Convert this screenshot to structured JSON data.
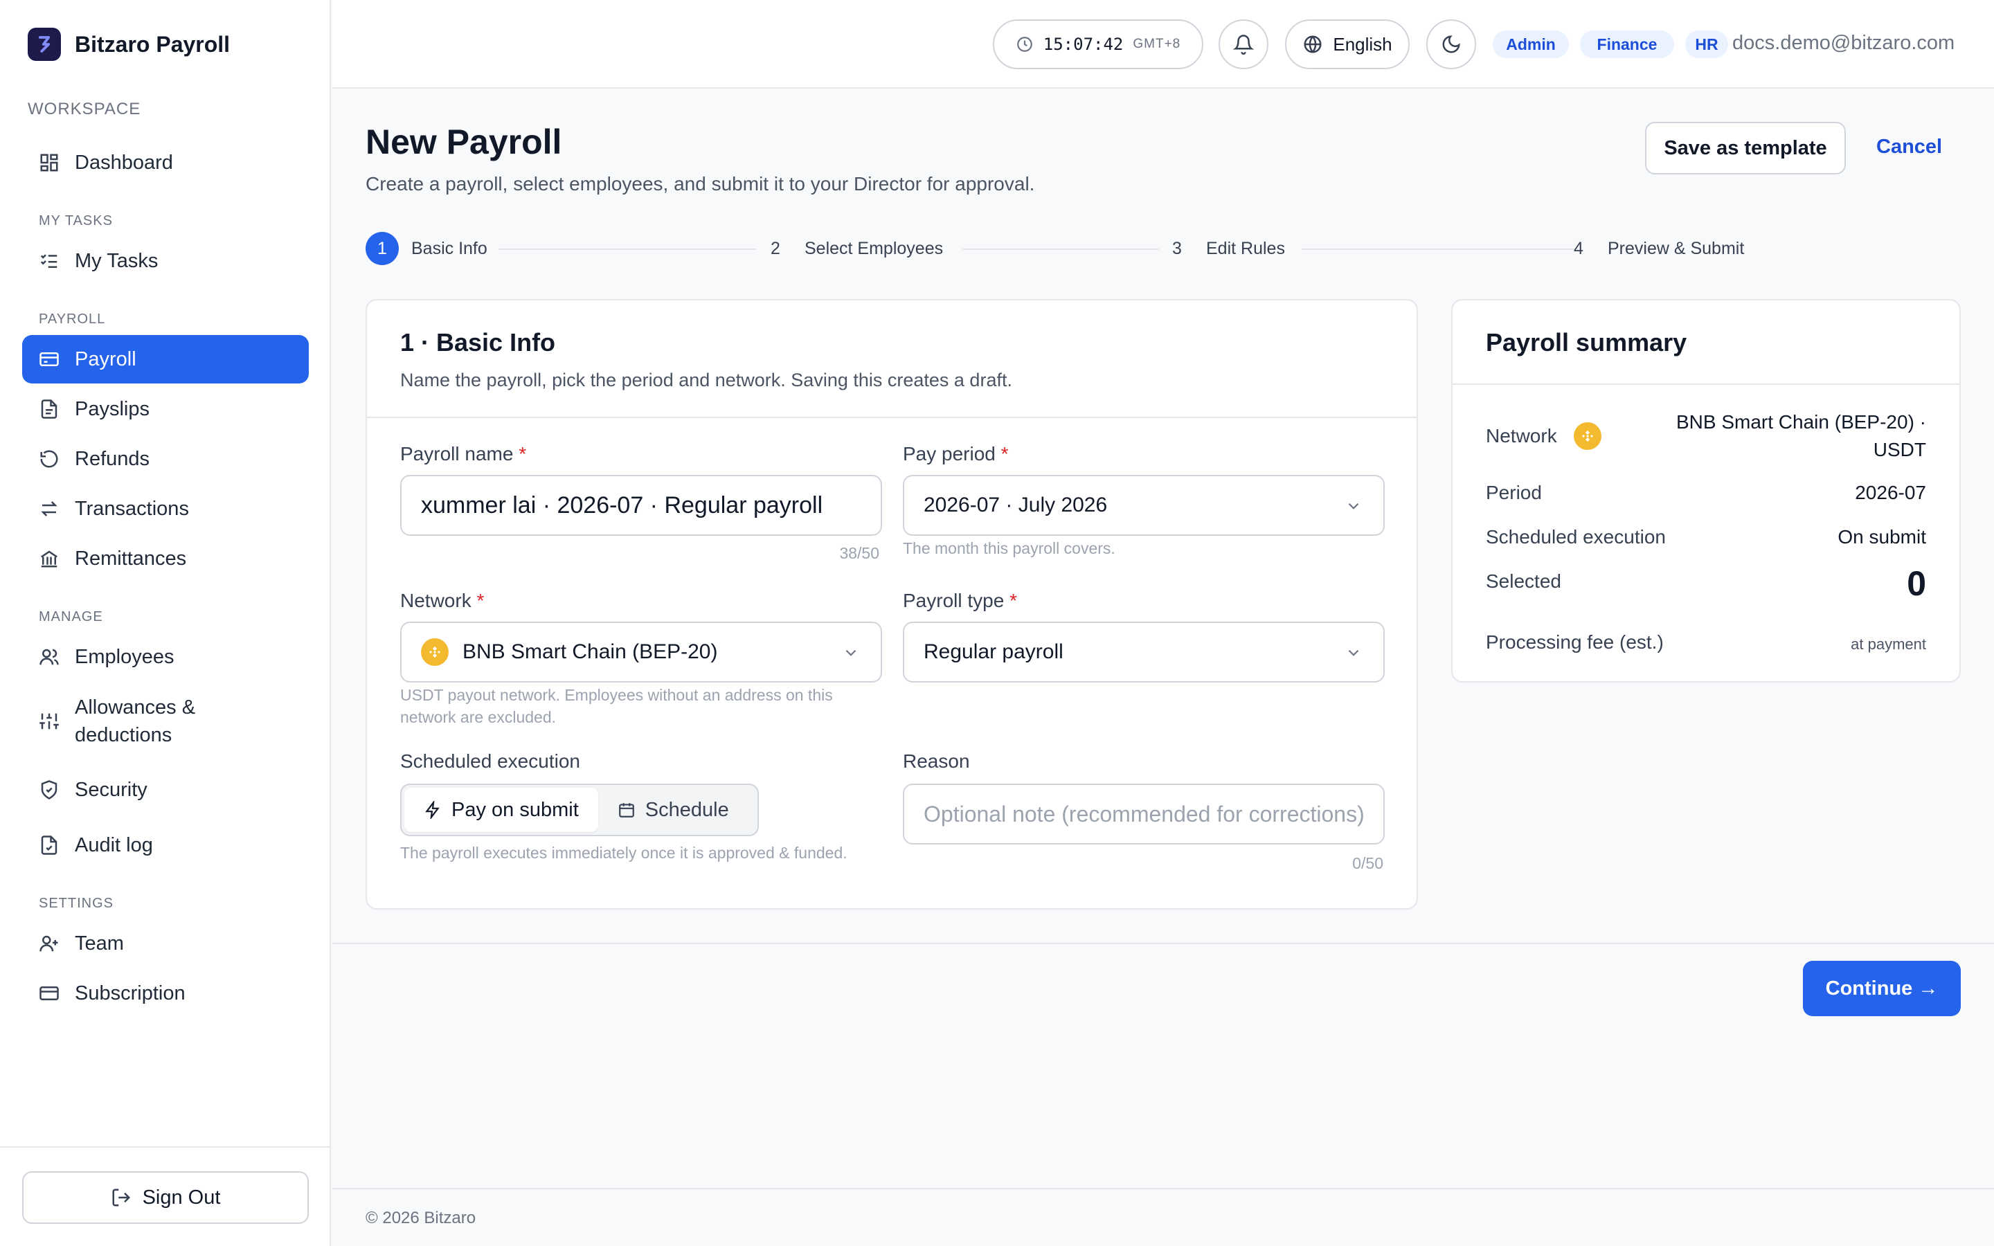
{
  "brand": {
    "name": "Bitzaro Payroll"
  },
  "sidebar": {
    "sections": {
      "workspace": "WORKSPACE",
      "my_tasks": "MY TASKS",
      "payroll": "PAYROLL",
      "manage": "MANAGE",
      "settings": "SETTINGS"
    },
    "items": {
      "dashboard": "Dashboard",
      "my_tasks": "My Tasks",
      "payroll": "Payroll",
      "payslips": "Payslips",
      "refunds": "Refunds",
      "transactions": "Transactions",
      "remittances": "Remittances",
      "employees": "Employees",
      "allowances": "Allowances & deductions",
      "security": "Security",
      "audit_log": "Audit log",
      "team": "Team",
      "subscription": "Subscription"
    },
    "active": "payroll",
    "sign_out": "Sign Out"
  },
  "topbar": {
    "time": "15:07:42",
    "timezone": "GMT+8",
    "language": "English",
    "roles": [
      "Admin",
      "Finance",
      "HR"
    ],
    "email": "docs.demo@bitzaro.com"
  },
  "page": {
    "title": "New Payroll",
    "subtitle": "Create a payroll, select employees, and submit it to your Director for approval.",
    "save_template": "Save as template",
    "cancel": "Cancel"
  },
  "steps": [
    {
      "num": "1",
      "label": "Basic Info",
      "active": true
    },
    {
      "num": "2",
      "label": "Select Employees",
      "active": false
    },
    {
      "num": "3",
      "label": "Edit Rules",
      "active": false
    },
    {
      "num": "4",
      "label": "Preview & Submit",
      "active": false
    }
  ],
  "form": {
    "title": "1 · Basic Info",
    "subtitle": "Name the payroll, pick the period and network. Saving this creates a draft.",
    "payroll_name": {
      "label": "Payroll name",
      "value": "xummer lai · 2026-07 · Regular payroll",
      "count": "38/50"
    },
    "pay_period": {
      "label": "Pay period",
      "value": "2026-07 · July 2026",
      "hint": "The month this payroll covers."
    },
    "network": {
      "label": "Network",
      "value": "BNB Smart Chain (BEP-20)",
      "hint": "USDT payout network. Employees without an address on this network are excluded."
    },
    "payroll_type": {
      "label": "Payroll type",
      "value": "Regular payroll"
    },
    "scheduled": {
      "label": "Scheduled execution",
      "options": [
        "Pay on submit",
        "Schedule"
      ],
      "selected": "Pay on submit",
      "hint": "The payroll executes immediately once it is approved & funded."
    },
    "reason": {
      "label": "Reason",
      "placeholder": "Optional note (recommended for corrections)",
      "count": "0/50"
    },
    "required_mark": "*"
  },
  "summary": {
    "title": "Payroll summary",
    "network_label": "Network",
    "network_value": "BNB Smart Chain (BEP-20) · USDT",
    "period_label": "Period",
    "period_value": "2026-07",
    "scheduled_label": "Scheduled execution",
    "scheduled_value": "On submit",
    "selected_label": "Selected",
    "selected_value": "0",
    "fee_label": "Processing fee (est.)",
    "fee_value": "at payment"
  },
  "actions": {
    "continue": "Continue →"
  },
  "footer": {
    "copyright": "© 2026 Bitzaro"
  },
  "colors": {
    "primary": "#2563eb",
    "bnb": "#f3ba2f",
    "required": "#dc2626"
  }
}
